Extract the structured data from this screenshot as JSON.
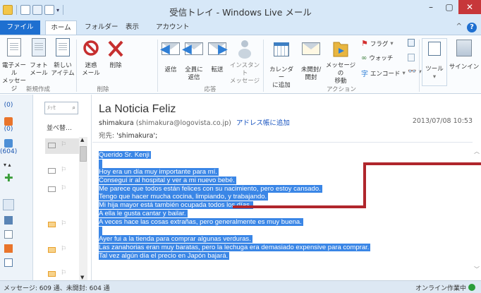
{
  "window": {
    "title": "受信トレイ - Windows Live メール"
  },
  "menu": {
    "tabs": [
      "ファイル",
      "ホーム",
      "フォルダー",
      "表示",
      "アカウント"
    ]
  },
  "ribbon": {
    "new_email": "電子メール\nメッセージ",
    "photo_email": "フォト\nメール",
    "new_item": "新しい\nアイテム",
    "junk": "迷惑\nメール",
    "delete": "削除",
    "reply": "返信",
    "reply_all": "全員に\n返信",
    "forward": "転送",
    "instant_message": "インスタント\nメッセージ",
    "add_calendar": "カレンダー\nに追加",
    "unread_read": "未開封/\n開封",
    "move": "メッセージの\n移動",
    "flag": "フラグ",
    "watch": "ウォッチ",
    "encoding": "エンコード",
    "tools": "ツール",
    "signin": "サインイン",
    "group_new": "新規作成",
    "group_delete": "削除",
    "group_respond": "応答",
    "group_action": "アクション"
  },
  "nav": {
    "counts": [
      "(0)",
      "(0)",
      "(604)"
    ]
  },
  "list": {
    "search_placeholder": "ﾒｯｾ",
    "sort_label": "並べ替…"
  },
  "message": {
    "subject": "La Noticia Feliz",
    "sender_name": "shimakura",
    "sender_email": "(shimakura@logovista.co.jp)",
    "add_contact": "アドレス帳に追加",
    "date": "2013/07/08 10:53",
    "to_label": "宛先:",
    "to_value": "'shimakura';",
    "body_lines": [
      "Querido Sr. Kenji",
      "",
      "Hoy era un día muy importante para mí.",
      "Conseguí ir al hospital y ver a mi nuevo bebé.",
      "Me parece que  todos están felices con su nacimiento, pero estoy cansado.",
      "Tengo que hacer mucha cocina, limpiando, y trabajando.",
      "Mi hija mayor está también ocupada todos los días.",
      "A ella le gusta cantar y bailar.",
      "A veces hace las cosas extrañas, pero generalmente es muy buena.",
      "",
      "Ayer fui a la tienda para comprar algunas verduras.",
      "Las zanahorias eran muy baratas, pero la lechuga era demasiado expensive para comprar.",
      "Tal vez algún día el precio en Japón bajará."
    ]
  },
  "status": {
    "left": "メッセージ: 609 通、未開封: 604 通",
    "right": "オンライン作業中"
  },
  "colors": {
    "titlebar": "#d7e8f8",
    "file_tab": "#1e6fd0",
    "selection": "#3a86e6",
    "annotation": "#b0262c",
    "close": "#c7373a"
  }
}
